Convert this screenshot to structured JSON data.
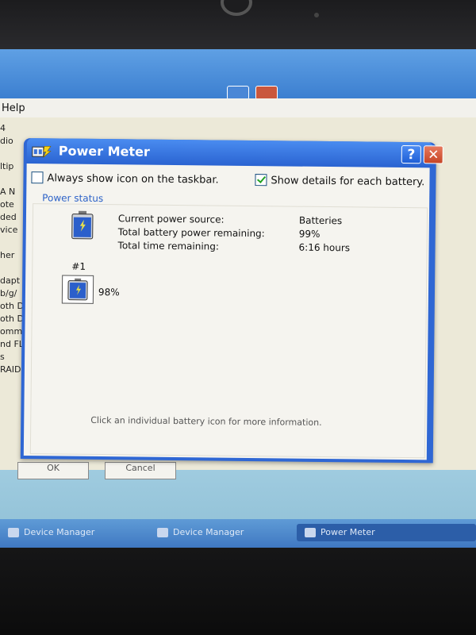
{
  "background_window": {
    "menu_help": "Help",
    "tree_fragments": [
      "4",
      "dio",
      "",
      "ltip",
      "",
      "A N",
      "ote",
      "ded",
      "vice",
      "",
      "her",
      "",
      "dapt",
      "b/g/",
      "oth D",
      "oth D",
      "omm",
      "nd FL",
      "s",
      "RAID"
    ],
    "ok_label": "OK",
    "cancel_label": "Cancel"
  },
  "taskbar": {
    "items": [
      {
        "label": "Device Manager"
      },
      {
        "label": "Device Manager"
      },
      {
        "label": "Power Meter"
      }
    ]
  },
  "dialog": {
    "title": "Power Meter",
    "help_button": "?",
    "close_button": "✕",
    "always_show_icon": {
      "label": "Always show icon on the taskbar.",
      "checked": false
    },
    "show_details": {
      "label": "Show details for each battery.",
      "checked": true
    },
    "group_title": "Power status",
    "status": [
      {
        "label": "Current power source:",
        "value": "Batteries"
      },
      {
        "label": "Total battery power remaining:",
        "value": "99%"
      },
      {
        "label": "Total time remaining:",
        "value": "6:16 hours"
      }
    ],
    "battery": {
      "number": "#1",
      "percent": "98%",
      "level": 0.98
    },
    "hint": "Click an individual battery icon for more information."
  },
  "colors": {
    "title_blue": "#2a63d1",
    "close_red": "#c64526",
    "group_label_blue": "#2b61c7"
  }
}
